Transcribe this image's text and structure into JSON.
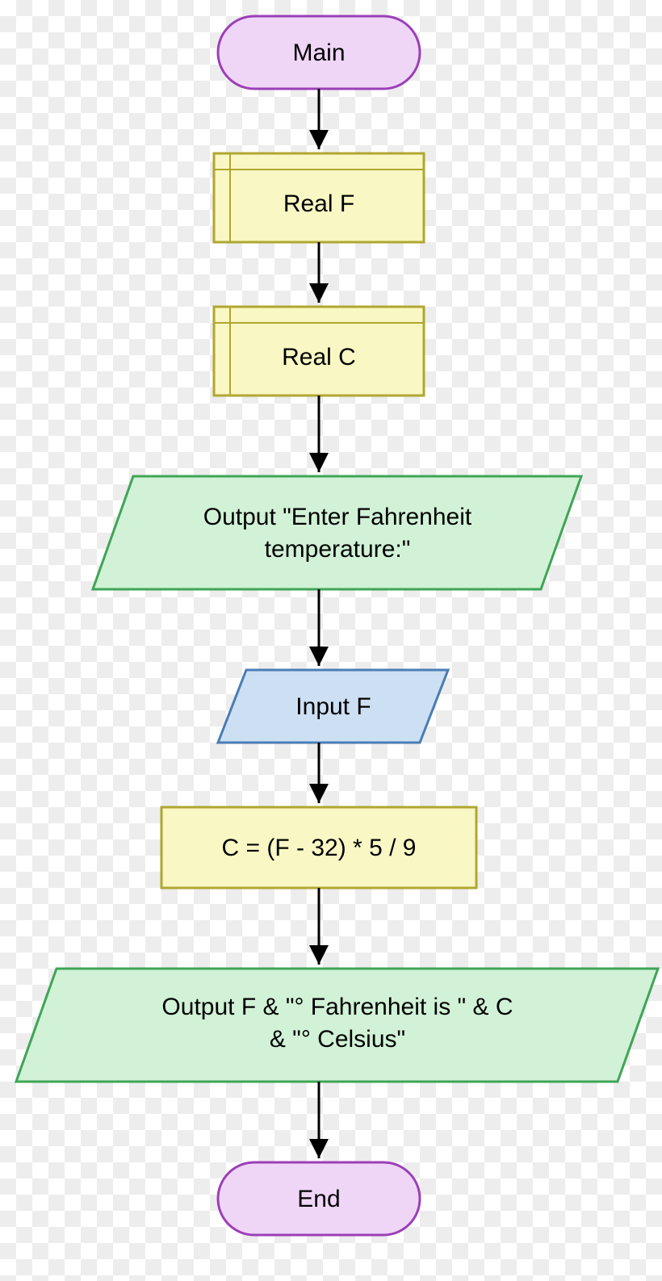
{
  "flowchart": {
    "nodes": [
      {
        "id": "start",
        "type": "terminator",
        "label": "Main"
      },
      {
        "id": "declF",
        "type": "declaration",
        "label": "Real F"
      },
      {
        "id": "declC",
        "type": "declaration",
        "label": "Real C"
      },
      {
        "id": "out1",
        "type": "io-output",
        "label": "Output \"Enter Fahrenheit temperature:\""
      },
      {
        "id": "in1",
        "type": "io-input",
        "label": "Input F"
      },
      {
        "id": "proc1",
        "type": "process",
        "label": "C = (F - 32) * 5 / 9"
      },
      {
        "id": "out2",
        "type": "io-output",
        "label": "Output F & \"° Fahrenheit is \" & C & \"° Celsius\""
      },
      {
        "id": "end",
        "type": "terminator",
        "label": "End"
      }
    ],
    "edges": [
      [
        "start",
        "declF"
      ],
      [
        "declF",
        "declC"
      ],
      [
        "declC",
        "out1"
      ],
      [
        "out1",
        "in1"
      ],
      [
        "in1",
        "proc1"
      ],
      [
        "proc1",
        "out2"
      ],
      [
        "out2",
        "end"
      ]
    ]
  },
  "colors": {
    "terminator_fill": "#efd6f7",
    "terminator_stroke": "#9c3fb8",
    "declaration_fill": "#f9f7c3",
    "declaration_stroke": "#b0a732",
    "process_fill": "#f9f7c3",
    "process_stroke": "#b0a732",
    "io_output_fill": "#d1f2d6",
    "io_output_stroke": "#3fa557",
    "io_input_fill": "#cddff3",
    "io_input_stroke": "#4a7db5",
    "arrow": "#000000"
  }
}
